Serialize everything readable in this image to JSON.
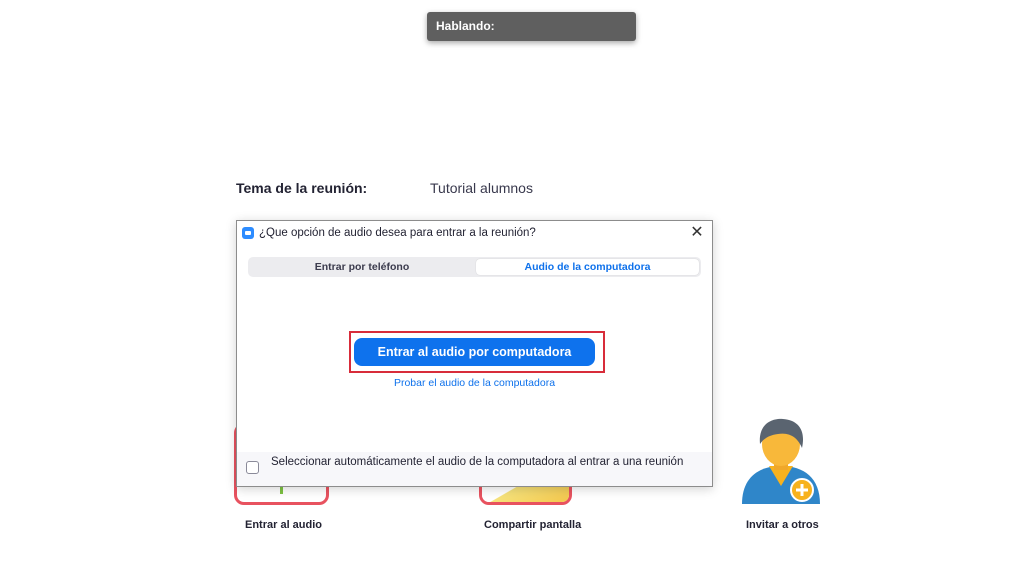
{
  "speaking": {
    "label": "Hablando:"
  },
  "meeting": {
    "topic_label": "Tema de la reunión:",
    "topic_value": "Tutorial alumnos"
  },
  "dialog": {
    "title": "¿Que opción de audio desea para entrar a la reunión?",
    "close_symbol": "✕",
    "tabs": [
      {
        "label": "Entrar por teléfono",
        "selected": false
      },
      {
        "label": "Audio de la computadora",
        "selected": true
      }
    ],
    "join_button": "Entrar al audio por computadora",
    "test_link": "Probar el audio de la computadora",
    "checkbox_label": "Seleccionar automáticamente el audio de la computadora al entrar a una reunión",
    "checkbox_checked": false
  },
  "actions": [
    {
      "label": "Entrar al audio",
      "icon": "audio-icon"
    },
    {
      "label": "Compartir pantalla",
      "icon": "share-screen-icon"
    },
    {
      "label": "Invitar a otros",
      "icon": "invite-user-icon"
    }
  ],
  "colors": {
    "accent": "#0e72ed",
    "highlight": "#d82c3a",
    "tile_border": "#e8525f"
  }
}
